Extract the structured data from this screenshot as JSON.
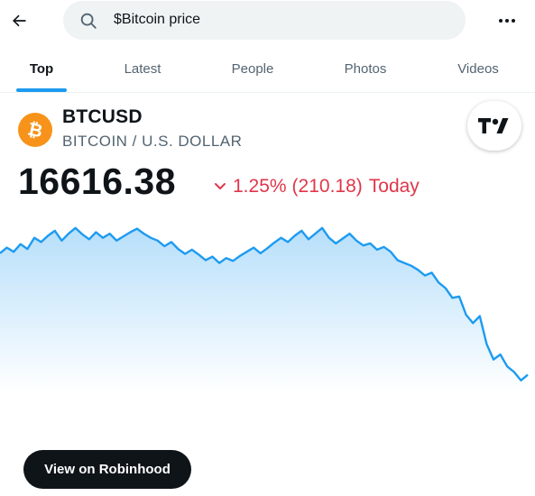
{
  "search": {
    "value": "$Bitcoin price"
  },
  "icons": {
    "back": "arrow-left-icon",
    "search": "search-icon",
    "more": "more-horizontal-icon",
    "coin": "bitcoin-icon",
    "tradingview": "tradingview-logo-icon",
    "trend": "chevron-down-icon"
  },
  "tabs": [
    {
      "label": "Top",
      "active": true
    },
    {
      "label": "Latest",
      "active": false
    },
    {
      "label": "People",
      "active": false
    },
    {
      "label": "Photos",
      "active": false
    },
    {
      "label": "Videos",
      "active": false
    }
  ],
  "quote": {
    "ticker": "BTCUSD",
    "name": "BITCOIN / U.S. DOLLAR",
    "price": "16616.38",
    "change_percent": "1.25%",
    "change_amount": "(210.18)",
    "period": "Today"
  },
  "cta": {
    "label": "View on Robinhood"
  },
  "colors": {
    "accent": "#1d9bf0",
    "negative": "#e0364a",
    "bitcoin": "#f7931a",
    "line": "#1d9bf0"
  },
  "chart_data": {
    "type": "area",
    "title": "",
    "xlabel": "",
    "ylabel": "",
    "values": [
      16790,
      16798,
      16792,
      16803,
      16796,
      16812,
      16806,
      16815,
      16822,
      16808,
      16818,
      16826,
      16817,
      16810,
      16820,
      16812,
      16818,
      16808,
      16814,
      16820,
      16825,
      16818,
      16812,
      16808,
      16800,
      16806,
      16796,
      16789,
      16795,
      16788,
      16780,
      16785,
      16776,
      16783,
      16779,
      16786,
      16792,
      16798,
      16790,
      16797,
      16805,
      16812,
      16806,
      16815,
      16822,
      16810,
      16818,
      16826,
      16812,
      16804,
      16811,
      16818,
      16808,
      16801,
      16804,
      16795,
      16799,
      16792,
      16780,
      16776,
      16772,
      16766,
      16758,
      16762,
      16748,
      16740,
      16726,
      16728,
      16702,
      16690,
      16700,
      16660,
      16638,
      16645,
      16628,
      16620,
      16608,
      16616
    ],
    "ylim": [
      16600,
      16840
    ],
    "grid": false,
    "legend": "none"
  }
}
